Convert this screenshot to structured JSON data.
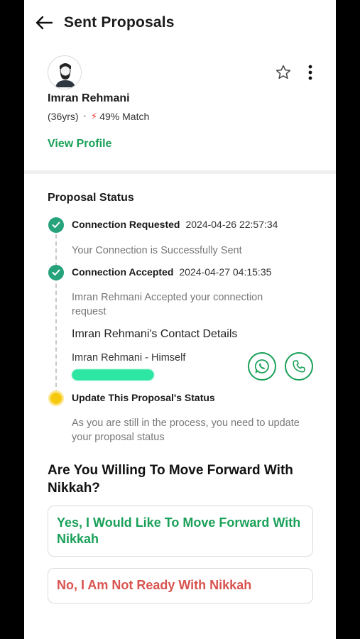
{
  "header": {
    "title": "Sent Proposals"
  },
  "profile": {
    "name": "Imran Rehmani",
    "age": "(36yrs)",
    "separator": "•",
    "match_icon": "⚡",
    "match": "49% Match",
    "view_profile": "View Profile"
  },
  "status": {
    "title": "Proposal Status",
    "steps": [
      {
        "label": "Connection Requested",
        "time": "2024-04-26 22:57:34",
        "desc": "Your Connection is Successfully Sent",
        "state": "done"
      },
      {
        "label": "Connection Accepted",
        "time": "2024-04-27 04:15:35",
        "desc": "Imran Rehmani Accepted your connection request",
        "state": "done"
      },
      {
        "label": "Update This Proposal's Status",
        "time": "",
        "desc": "As you are still in the process, you need to update your proposal status",
        "state": "pending"
      }
    ],
    "contact": {
      "title": "Imran Rehmani's Contact Details",
      "who": "Imran Rehmani - Himself"
    }
  },
  "question": {
    "text": "Are You Willing To Move Forward With Nikkah?",
    "yes": "Yes, I Would Like To Move Forward With Nikkah",
    "no": "No, I Am Not Ready With Nikkah"
  },
  "colors": {
    "accent": "#1aa058",
    "check": "#26a37a",
    "pending": "#f6c90e",
    "negative": "#d9534f"
  },
  "icons": [
    "back-arrow-icon",
    "star-icon",
    "more-vertical-icon",
    "whatsapp-icon",
    "phone-icon",
    "check-icon"
  ]
}
